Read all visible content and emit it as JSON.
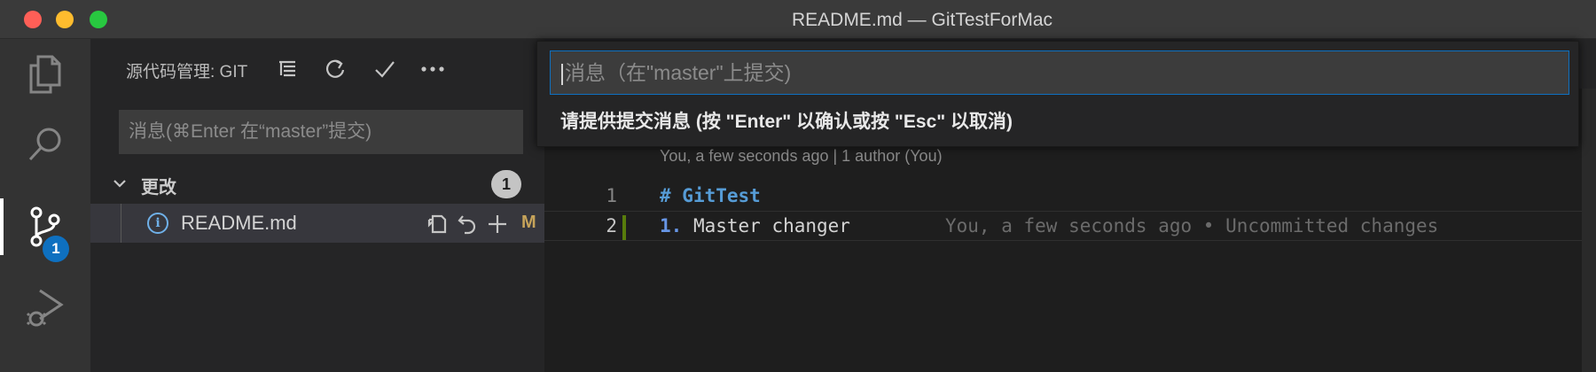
{
  "window": {
    "title": "README.md — GitTestForMac"
  },
  "activity_bar": {
    "items": [
      {
        "icon": "files-icon"
      },
      {
        "icon": "search-icon"
      },
      {
        "icon": "source-control-icon",
        "badge": "1",
        "active": true
      },
      {
        "icon": "run-debug-icon"
      }
    ]
  },
  "sidebar": {
    "title": "源代码管理: GIT",
    "actions": [
      "view-as-tree-icon",
      "refresh-icon",
      "commit-check-icon",
      "more-actions-icon"
    ],
    "commit_placeholder": "消息(⌘Enter 在“master”提交)",
    "changes": {
      "label": "更改",
      "count": "1",
      "files": [
        {
          "name": "README.md",
          "status": "M"
        }
      ]
    }
  },
  "editor": {
    "blame_header": "You, a few seconds ago | 1 author (You)",
    "lines": [
      {
        "number": "1",
        "marker": "# ",
        "text": "GitTest"
      },
      {
        "number": "2",
        "marker": "1. ",
        "text": "Master changer",
        "blame": "You, a few seconds ago • Uncommitted changes"
      }
    ]
  },
  "quick_input": {
    "placeholder": "消息（在\"master\"上提交)",
    "message": "请提供提交消息 (按 \"Enter\" 以确认或按 \"Esc\" 以取消)"
  },
  "colors": {
    "accent": "#0e70c0",
    "modified": "#c6a35a",
    "gutter_modified": "#587c0c"
  }
}
